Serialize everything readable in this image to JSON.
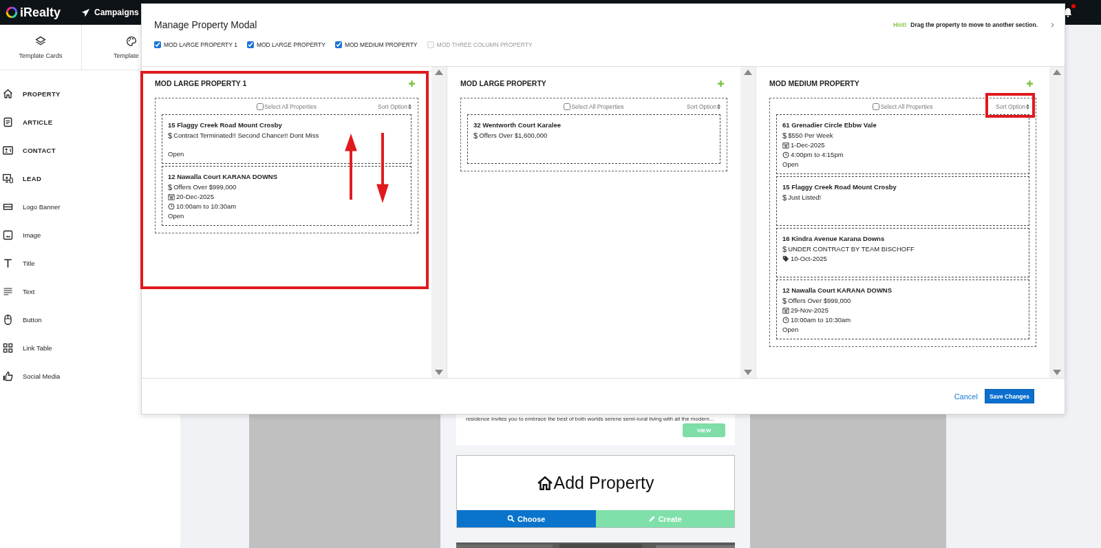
{
  "topbar": {
    "logo": "iRealty",
    "nav": [
      {
        "label": "Campaigns"
      }
    ],
    "notifications_unread": true
  },
  "sidebar": {
    "tabs": [
      {
        "label": "Template Cards"
      },
      {
        "label": "Template"
      }
    ],
    "items": [
      {
        "label": "PROPERTY",
        "kind": "card"
      },
      {
        "label": "ARTICLE",
        "kind": "card"
      },
      {
        "label": "CONTACT",
        "kind": "card"
      },
      {
        "label": "LEAD",
        "kind": "card"
      },
      {
        "label": "Logo Banner",
        "kind": "block"
      },
      {
        "label": "Image",
        "kind": "block"
      },
      {
        "label": "Title",
        "kind": "block"
      },
      {
        "label": "Text",
        "kind": "block"
      },
      {
        "label": "Button",
        "kind": "block"
      },
      {
        "label": "Link Table",
        "kind": "block"
      },
      {
        "label": "Social Media",
        "kind": "block"
      }
    ]
  },
  "editor": {
    "snippet": "residence invites you to embrace the best of both worlds serene semi-rural living with all the modern...",
    "view_button": "VIEW",
    "add_property": {
      "title": "Add Property",
      "choose": "Choose",
      "create": "Create"
    }
  },
  "modal": {
    "title": "Manage Property Modal",
    "hint": {
      "label": "Hint!",
      "text": "Drag the property to move to another section."
    },
    "sections": [
      {
        "label": "MOD LARGE PROPERTY 1",
        "checked": true,
        "disabled": false
      },
      {
        "label": "MOD LARGE PROPERTY",
        "checked": true,
        "disabled": false
      },
      {
        "label": "MOD MEDIUM PROPERTY",
        "checked": true,
        "disabled": false
      },
      {
        "label": "MOD THREE COLUMN PROPERTY",
        "checked": false,
        "disabled": true
      }
    ],
    "columns": [
      {
        "title": "MOD LARGE PROPERTY 1",
        "select_all": "Select All Properties",
        "select_all_checked": false,
        "sort": "Sort Option",
        "highlighted": true,
        "sort_highlighted": false,
        "properties": [
          {
            "address": "15 Flaggy Creek Road Mount Crosby",
            "lines": [
              {
                "kind": "price",
                "symbol": "$",
                "text": "Contract Terminated!! Second Chance!! Dont Miss"
              },
              {
                "kind": "status",
                "text": "Open"
              }
            ]
          },
          {
            "address": "12 Nawalla Court KARANA DOWNS",
            "lines": [
              {
                "kind": "price",
                "symbol": "$",
                "text": "Offers Over $999,000"
              },
              {
                "kind": "date",
                "text": "20-Dec-2025"
              },
              {
                "kind": "time",
                "text": "10:00am to 10:30am"
              },
              {
                "kind": "status",
                "text": "Open"
              }
            ]
          }
        ]
      },
      {
        "title": "MOD LARGE PROPERTY",
        "select_all": "Select All Properties",
        "select_all_checked": false,
        "sort": "Sort Option",
        "highlighted": false,
        "sort_highlighted": false,
        "properties": [
          {
            "address": "32 Wentworth Court Karalee",
            "lines": [
              {
                "kind": "price",
                "symbol": "$",
                "text": "Offers Over $1,600,000"
              }
            ]
          }
        ]
      },
      {
        "title": "MOD MEDIUM PROPERTY",
        "select_all": "Select All Properties",
        "select_all_checked": false,
        "sort": "Sort Option",
        "highlighted": false,
        "sort_highlighted": true,
        "properties": [
          {
            "address": "61 Grenadier Circle Ebbw Vale",
            "lines": [
              {
                "kind": "price",
                "symbol": "$",
                "text": "$550 Per Week"
              },
              {
                "kind": "date",
                "text": "1-Dec-2025"
              },
              {
                "kind": "time",
                "text": "4:00pm to 4:15pm"
              },
              {
                "kind": "status",
                "text": "Open"
              }
            ]
          },
          {
            "address": "15 Flaggy Creek Road Mount Crosby",
            "lines": [
              {
                "kind": "price",
                "symbol": "$",
                "text": "Just Listed!"
              }
            ]
          },
          {
            "address": "16 Kindra Avenue Karana Downs",
            "lines": [
              {
                "kind": "price",
                "symbol": "$",
                "text": "UNDER CONTRACT BY TEAM BISCHOFF"
              },
              {
                "kind": "tag",
                "text": "10-Oct-2025"
              }
            ]
          },
          {
            "address": "12 Nawalla Court KARANA DOWNS",
            "lines": [
              {
                "kind": "price",
                "symbol": "$",
                "text": "Offers Over $999,000"
              },
              {
                "kind": "date",
                "text": "29-Nov-2025"
              },
              {
                "kind": "time",
                "text": "10:00am to 10:30am"
              },
              {
                "kind": "status",
                "text": "Open"
              }
            ]
          }
        ]
      }
    ],
    "cancel": "Cancel",
    "save": "Save Changes"
  }
}
